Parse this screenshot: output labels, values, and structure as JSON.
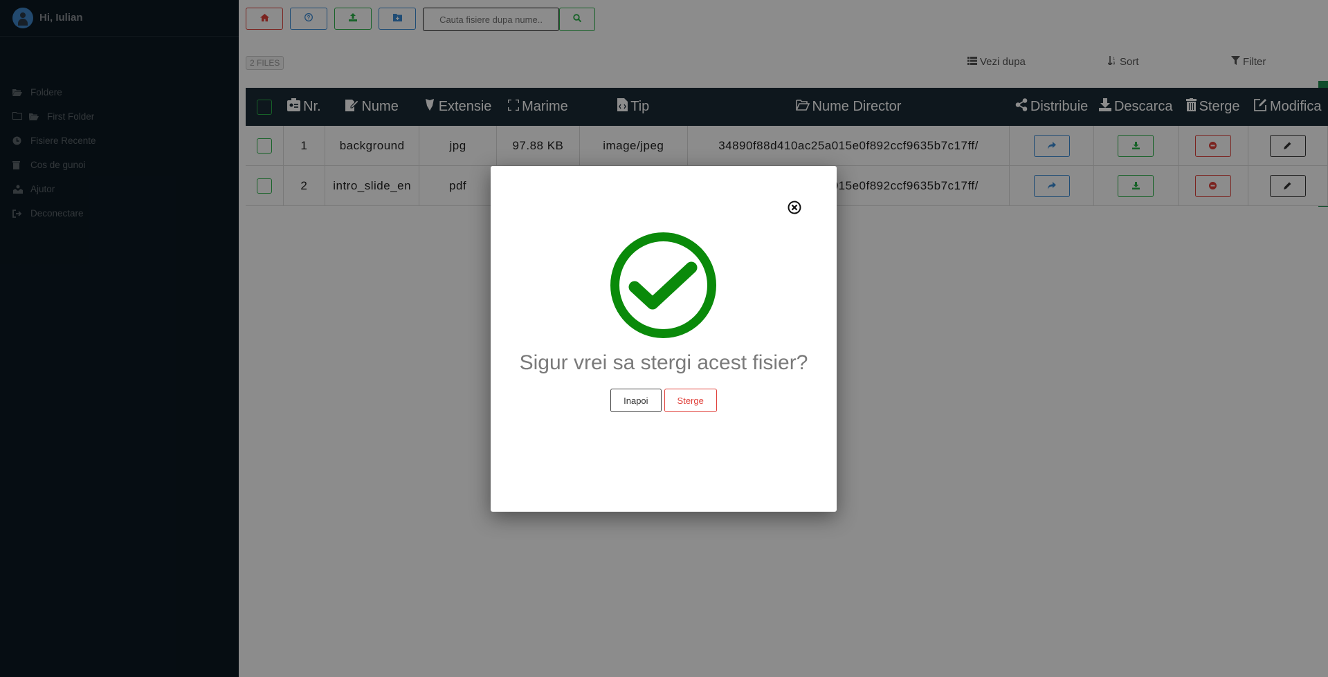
{
  "user": {
    "greeting": "Hi, Iulian"
  },
  "sidebar": {
    "items": [
      {
        "label": "Foldere",
        "icon": "folder-open-icon"
      },
      {
        "label": "First Folder",
        "icon": "folder-open-icon"
      },
      {
        "label": "Fisiere Recente",
        "icon": "clock-icon"
      },
      {
        "label": "Cos de gunoi",
        "icon": "trash-icon"
      },
      {
        "label": "Ajutor",
        "icon": "help-icon"
      },
      {
        "label": "Deconectare",
        "icon": "sign-out-icon"
      }
    ]
  },
  "toolbar": {
    "search_placeholder": "Cauta fisiere dupa nume.."
  },
  "files_info": {
    "count_label": "2 FILES"
  },
  "view_controls": {
    "view_by": "Vezi dupa",
    "sort": "Sort",
    "filter": "Filter"
  },
  "table": {
    "headers": [
      "Nr.",
      "Nume",
      "Extensie",
      "Marime",
      "Tip",
      "Nume Director",
      "Distribuie",
      "Descarca",
      "Sterge",
      "Modifica"
    ],
    "rows": [
      {
        "nr": "1",
        "name": "background",
        "ext": "jpg",
        "size": "97.88 KB",
        "type": "image/jpeg",
        "dir": "34890f88d410ac25a015e0f892ccf9635b7c17ff/"
      },
      {
        "nr": "2",
        "name": "intro_slide_en",
        "ext": "pdf",
        "size": "",
        "type": "",
        "dir": "34890f88d410ac25a015e0f892ccf9635b7c17ff/"
      }
    ]
  },
  "modal": {
    "title": "Sigur vrei sa stergi acest fisier?",
    "back_label": "Inapoi",
    "delete_label": "Sterge"
  },
  "colors": {
    "sidebar_bg": "#0b1822",
    "table_header_bg": "#1a2a36",
    "success_green": "#0a8a0a",
    "danger": "#e0403a"
  }
}
